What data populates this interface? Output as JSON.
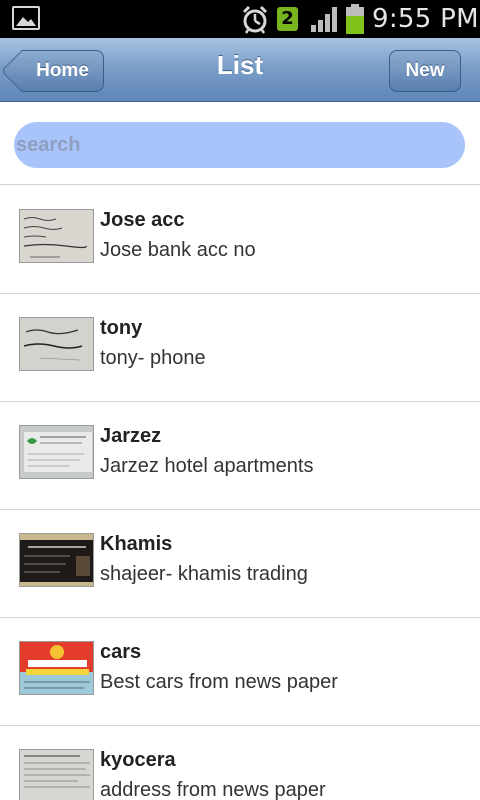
{
  "status_bar": {
    "time": "9:55 PM",
    "notification_count": "2",
    "icons": [
      "gallery-icon",
      "alarm-icon",
      "signal-icon",
      "battery-icon"
    ]
  },
  "header": {
    "title": "List",
    "home_label": "Home",
    "new_label": "New"
  },
  "search": {
    "placeholder": "search"
  },
  "items": [
    {
      "title": "Jose acc",
      "subtitle": "Jose bank acc no",
      "thumb": "handwritten-note"
    },
    {
      "title": "tony",
      "subtitle": "tony- phone",
      "thumb": "handwritten-note"
    },
    {
      "title": "Jarzez",
      "subtitle": "Jarzez hotel apartments",
      "thumb": "business-card"
    },
    {
      "title": "Khamis",
      "subtitle": "shajeer- khamis trading",
      "thumb": "dark-business-card"
    },
    {
      "title": "cars",
      "subtitle": "Best cars from news paper",
      "thumb": "best-cars-ad"
    },
    {
      "title": "kyocera",
      "subtitle": "address from news paper",
      "thumb": "newspaper-clipping"
    }
  ],
  "colors": {
    "header_top": "#a9c3e0",
    "header_bottom": "#5f86b7",
    "search_bg": "#a9c4fb",
    "notification_badge": "#79b51e",
    "battery": "#7ec21a"
  }
}
